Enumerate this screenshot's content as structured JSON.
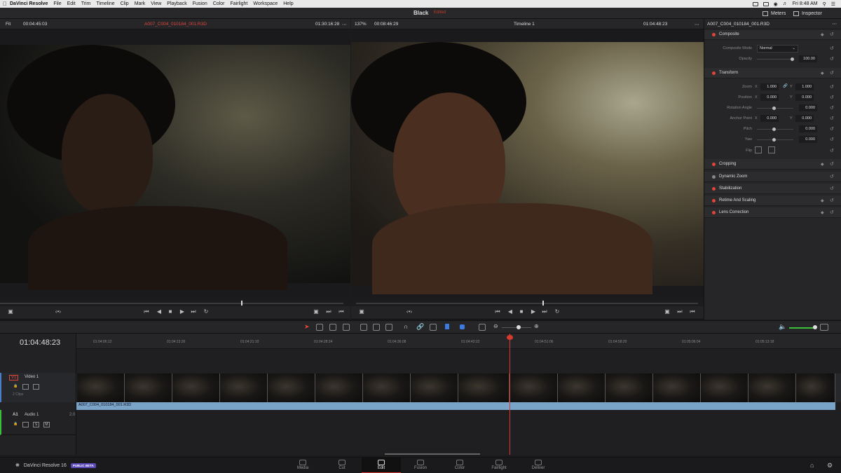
{
  "menubar": {
    "app": "DaVinci Resolve",
    "items": [
      "File",
      "Edit",
      "Trim",
      "Timeline",
      "Clip",
      "Mark",
      "View",
      "Playback",
      "Fusion",
      "Color",
      "Fairlight",
      "Workspace",
      "Help"
    ],
    "clock": "Fri 8:48 AM"
  },
  "titlebar": {
    "project": "Black",
    "status": "Edited",
    "meters": "Meters",
    "inspector": "Inspector"
  },
  "source_viewer": {
    "zoom": "Fit",
    "duration": "00:04:45:03",
    "clip_name": "A007_C004_010184_001.R3D",
    "timecode": "01:30:16:28"
  },
  "timeline_viewer": {
    "zoom": "137%",
    "duration": "00:08:46:29",
    "timeline_name": "Timeline 1",
    "timecode": "01:04:48:23"
  },
  "inspector": {
    "clip_name": "A007_C004_010184_001.R3D",
    "composite": {
      "label": "Composite",
      "mode_label": "Composite Mode",
      "mode_value": "Normal",
      "opacity_label": "Opacity",
      "opacity_value": "100.00"
    },
    "transform": {
      "label": "Transform",
      "zoom_label": "Zoom",
      "zoom_x": "1.000",
      "zoom_y": "1.000",
      "position_label": "Position",
      "position_x": "0.000",
      "position_y": "0.000",
      "rotation_label": "Rotation Angle",
      "rotation_value": "0.000",
      "anchor_label": "Anchor Point",
      "anchor_x": "0.000",
      "anchor_y": "0.000",
      "pitch_label": "Pitch",
      "pitch_value": "0.000",
      "yaw_label": "Yaw",
      "yaw_value": "0.000",
      "flip_label": "Flip",
      "x_axis": "X",
      "y_axis": "Y"
    },
    "sections": [
      "Cropping",
      "Dynamic Zoom",
      "Stabilization",
      "Retime And Scaling",
      "Lens Correction"
    ]
  },
  "timeline": {
    "timecode": "01:04:48:23",
    "ruler": [
      "01:04:06:12",
      "01:04:13:26",
      "01:04:21:10",
      "01:04:28:24",
      "01:04:36:08",
      "01:04:43:22",
      "01:04:51:06",
      "01:04:58:20",
      "01:05:06:04",
      "01:05:13:18"
    ],
    "video_track": {
      "id": "V1",
      "name": "Video 1",
      "clips": "2 Clips"
    },
    "audio_track": {
      "id": "A1",
      "name": "Audio 1",
      "channels": "2.0"
    },
    "clip_label": "A007_C004_010184_001.R3D"
  },
  "pages": [
    "Media",
    "Cut",
    "Edit",
    "Fusion",
    "Color",
    "Fairlight",
    "Deliver"
  ],
  "active_page": "Edit",
  "brand": {
    "name": "DaVinci Resolve 16",
    "badge": "PUBLIC BETA"
  }
}
